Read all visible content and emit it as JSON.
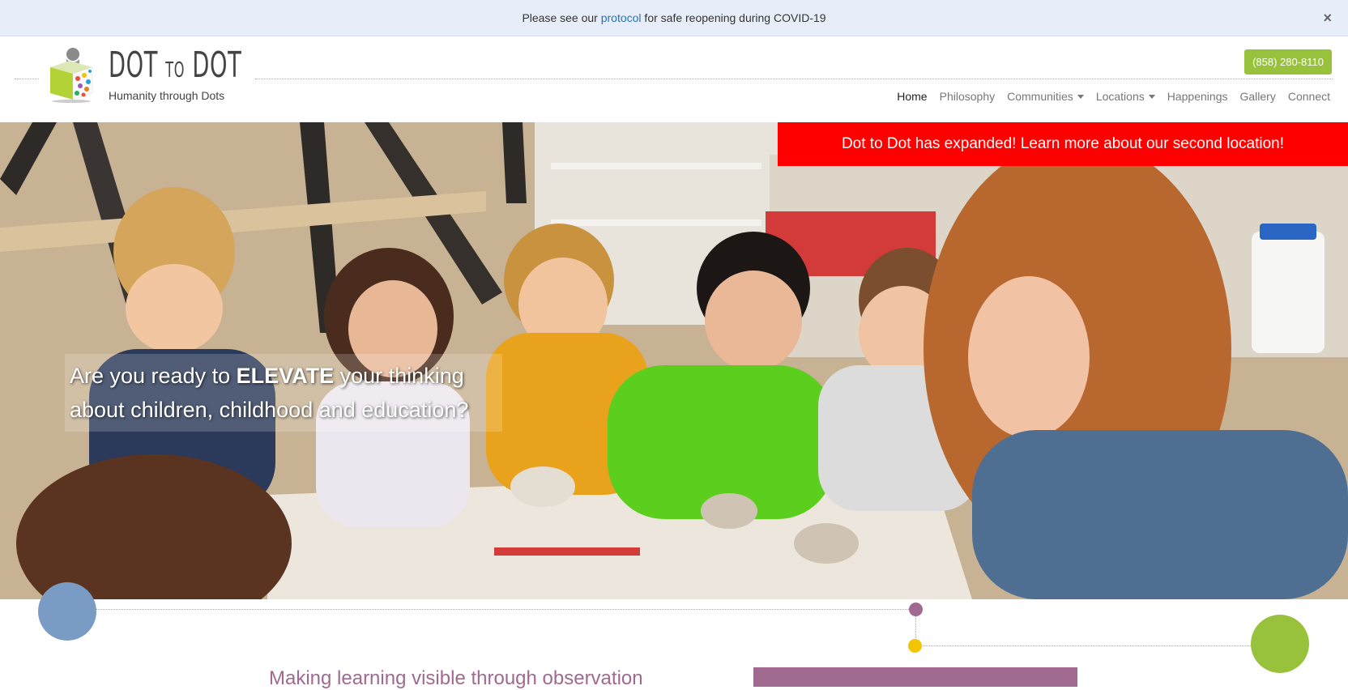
{
  "alert": {
    "prefix": "Please see our ",
    "link": "protocol",
    "suffix": " for safe reopening during COVID-19",
    "close": "×"
  },
  "logo": {
    "title_a": "DOT",
    "title_mid": "TO",
    "title_b": "DOT",
    "tagline": "Humanity through Dots"
  },
  "header": {
    "phone": "(858) 280-8110"
  },
  "nav": {
    "items": [
      {
        "label": "Home",
        "active": true,
        "dropdown": false
      },
      {
        "label": "Philosophy",
        "active": false,
        "dropdown": false
      },
      {
        "label": "Communities",
        "active": false,
        "dropdown": true
      },
      {
        "label": "Locations",
        "active": false,
        "dropdown": true
      },
      {
        "label": "Happenings",
        "active": false,
        "dropdown": false
      },
      {
        "label": "Gallery",
        "active": false,
        "dropdown": false
      },
      {
        "label": "Connect",
        "active": false,
        "dropdown": false
      }
    ]
  },
  "hero": {
    "banner": "Dot to Dot has expanded! Learn more about our second location!",
    "line1_pre": "Are you ready to ",
    "line1_bold": "ELEVATE",
    "line1_post": " your thinking",
    "line2": "about children, childhood and education?"
  },
  "section": {
    "title": "Making learning visible through observation"
  },
  "colors": {
    "accent_green": "#99c23c",
    "banner_red": "#ff0000",
    "purple": "#a06a90",
    "blue_dot": "#7a9cc4",
    "yellow_dot": "#f5c400"
  }
}
